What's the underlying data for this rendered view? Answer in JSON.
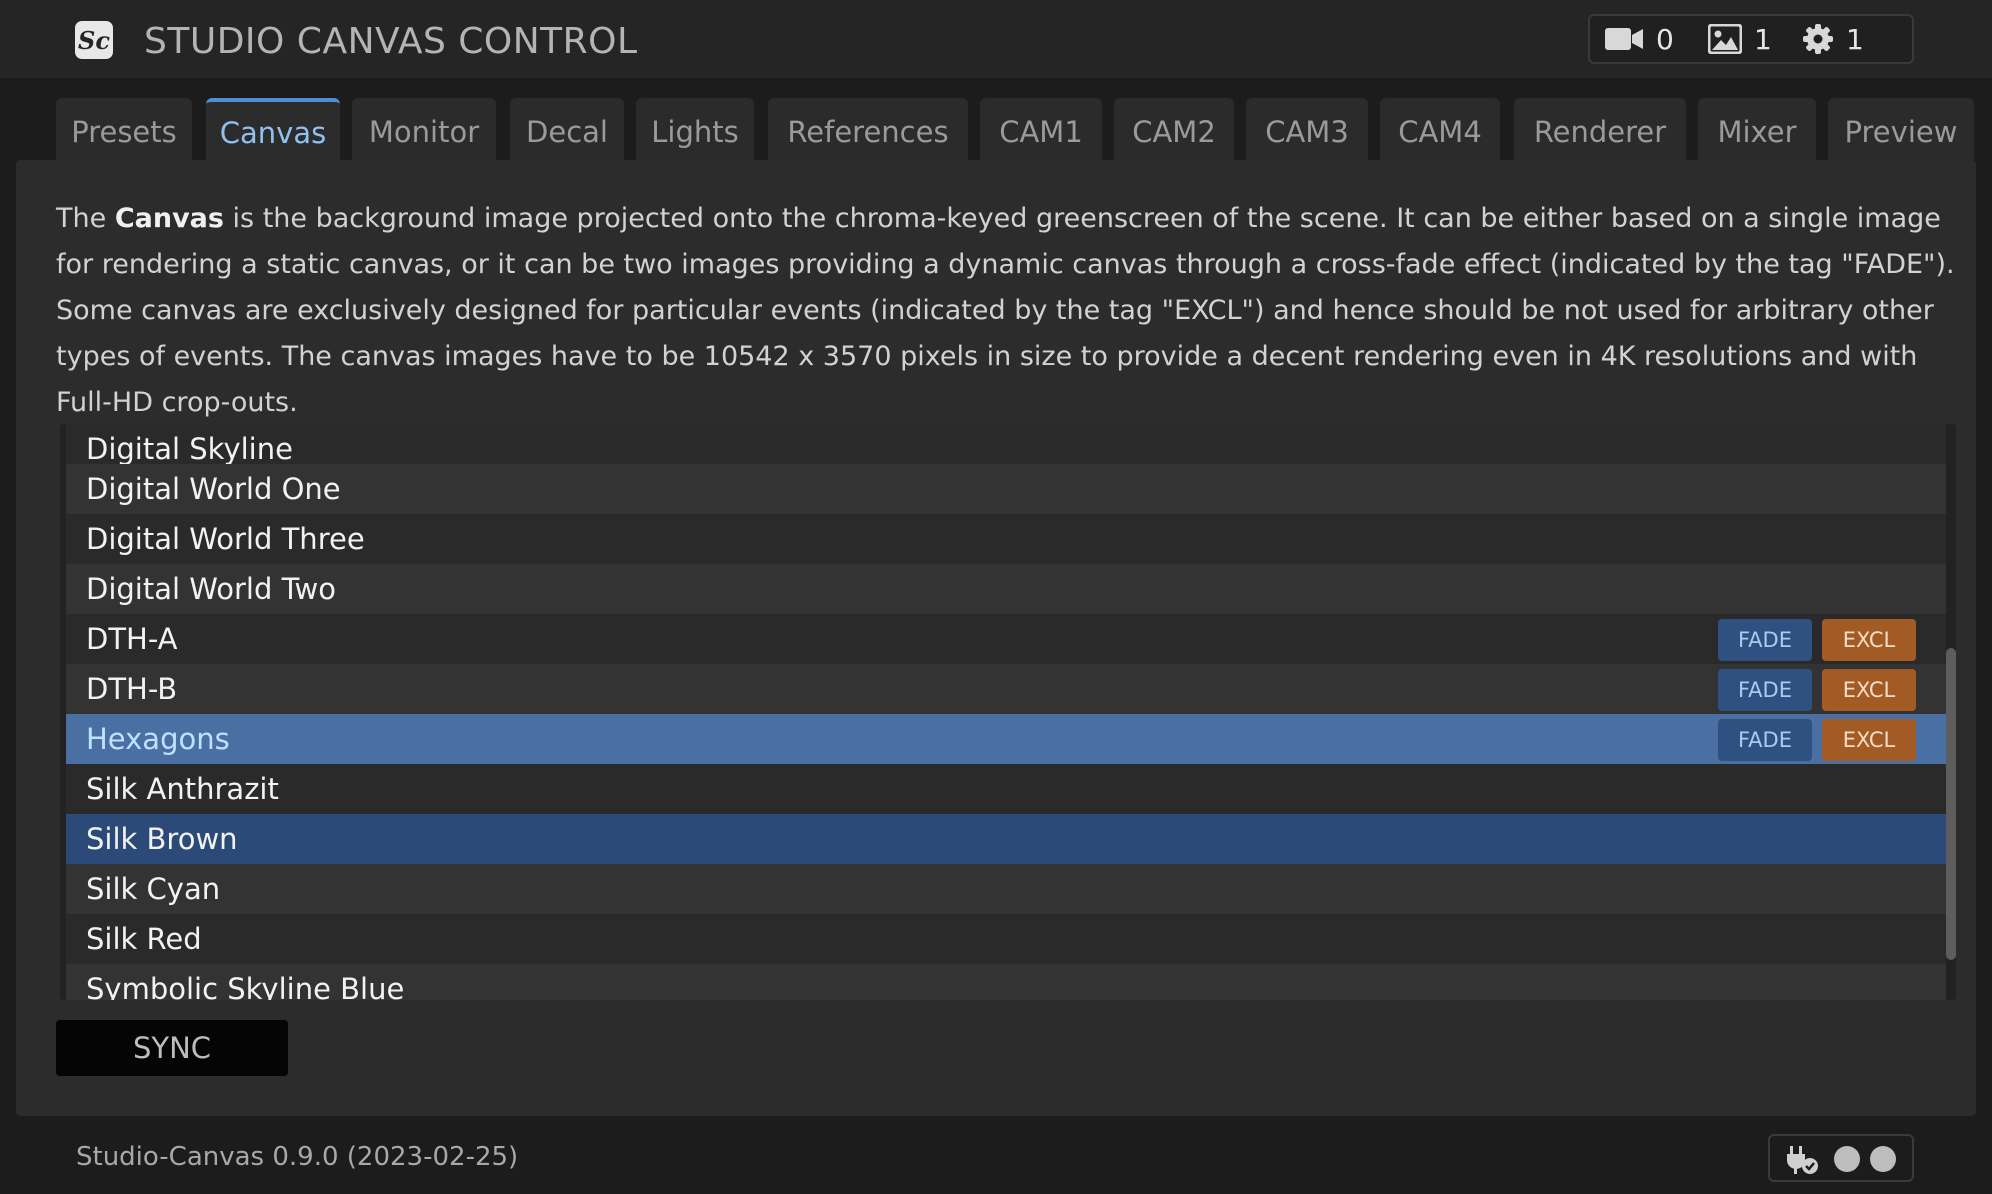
{
  "header": {
    "title": "STUDIO CANVAS CONTROL",
    "logo_icon": "sc-logo-icon",
    "stats": [
      {
        "icon": "video-camera-icon",
        "value": "0"
      },
      {
        "icon": "image-icon",
        "value": "1"
      },
      {
        "icon": "gear-icon",
        "value": "1"
      }
    ]
  },
  "tabs": [
    {
      "label": "Presets",
      "active": false
    },
    {
      "label": "Canvas",
      "active": true
    },
    {
      "label": "Monitor",
      "active": false
    },
    {
      "label": "Decal",
      "active": false
    },
    {
      "label": "Lights",
      "active": false
    },
    {
      "label": "References",
      "active": false
    },
    {
      "label": "CAM1",
      "active": false
    },
    {
      "label": "CAM2",
      "active": false
    },
    {
      "label": "CAM3",
      "active": false
    },
    {
      "label": "CAM4",
      "active": false
    },
    {
      "label": "Renderer",
      "active": false
    },
    {
      "label": "Mixer",
      "active": false
    },
    {
      "label": "Preview",
      "active": false
    }
  ],
  "description": {
    "prefix": "The ",
    "bold": "Canvas",
    "rest": " is the background image projected onto the chroma-keyed greenscreen of the scene. It can be either based on a single image for rendering a static canvas, or it can be two images providing a dynamic canvas through a cross-fade effect (indicated by the tag \"FADE\"). Some canvas are exclusively designed for particular events (indicated by the tag \"EXCL\") and hence should be not used for arbitrary other types of events. The canvas images have to be 10542 x 3570 pixels in size to provide a decent rendering even in 4K resolutions and with Full-HD crop-outs."
  },
  "canvas_list": [
    {
      "name": "Digital Skyline",
      "fade": false,
      "excl": false,
      "state": ""
    },
    {
      "name": "Digital World One",
      "fade": false,
      "excl": false,
      "state": ""
    },
    {
      "name": "Digital World Three",
      "fade": false,
      "excl": false,
      "state": ""
    },
    {
      "name": "Digital World Two",
      "fade": false,
      "excl": false,
      "state": ""
    },
    {
      "name": "DTH-A",
      "fade": true,
      "excl": true,
      "state": ""
    },
    {
      "name": "DTH-B",
      "fade": true,
      "excl": true,
      "state": ""
    },
    {
      "name": "Hexagons",
      "fade": true,
      "excl": true,
      "state": "selected"
    },
    {
      "name": "Silk Anthrazit",
      "fade": false,
      "excl": false,
      "state": ""
    },
    {
      "name": "Silk Brown",
      "fade": false,
      "excl": false,
      "state": "active"
    },
    {
      "name": "Silk Cyan",
      "fade": false,
      "excl": false,
      "state": ""
    },
    {
      "name": "Silk Red",
      "fade": false,
      "excl": false,
      "state": ""
    },
    {
      "name": "Symbolic Skyline Blue",
      "fade": false,
      "excl": false,
      "state": ""
    }
  ],
  "tag_labels": {
    "fade": "FADE",
    "excl": "EXCL"
  },
  "sync_label": "SYNC",
  "footer": {
    "version": "Studio-Canvas 0.9.0 (2023-02-25)",
    "status_icon": "plug-connected-icon"
  },
  "colors": {
    "accent": "#4d8fd6",
    "selected_row": "#4a70a3",
    "active_row": "#2b4a78",
    "fade_tag": "#2f5181",
    "excl_tag": "#a35b26"
  }
}
